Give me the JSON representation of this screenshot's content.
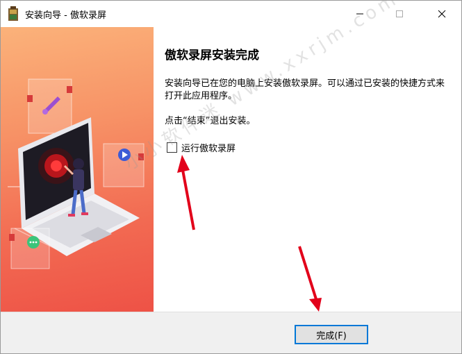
{
  "window": {
    "title": "安装向导 - 傲软录屏",
    "controls": {
      "minimize": "minimize-icon",
      "maximize": "maximize-icon",
      "close": "close-icon"
    }
  },
  "page": {
    "heading": "傲软录屏安装完成",
    "description": "安装向导已在您的电脑上安装傲软录屏。可以通过已安装的快捷方式来打开此应用程序。",
    "hint": "点击“结束”退出安装。",
    "run_checkbox": {
      "label": "运行傲软录屏",
      "checked": false
    }
  },
  "footer": {
    "finish_label": "完成(F)"
  },
  "watermark": "小小软件迷 www.xxrjm.com",
  "colors": {
    "accent": "#0078d7",
    "banner_top": "#fbb27a",
    "banner_bottom": "#ee5246",
    "arrow": "#e2001a"
  }
}
